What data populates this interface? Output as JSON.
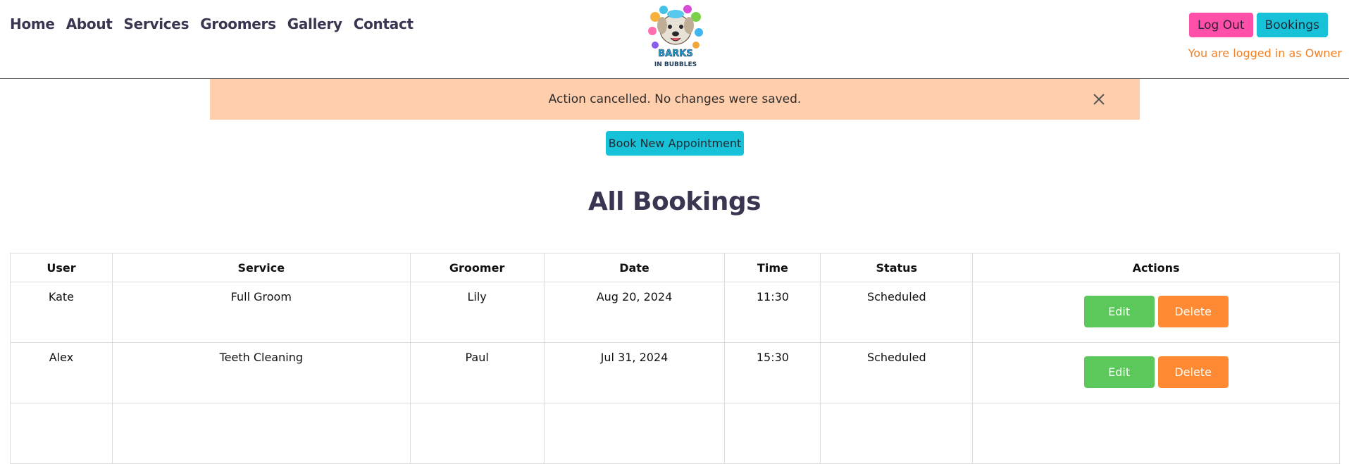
{
  "nav": {
    "items": [
      "Home",
      "About",
      "Services",
      "Groomers",
      "Gallery",
      "Contact"
    ]
  },
  "logo": {
    "name": "barks-in-bubbles-logo",
    "text_line1": "BARKS",
    "text_line2": "IN BUBBLES"
  },
  "auth": {
    "logout_label": "Log Out",
    "bookings_label": "Bookings",
    "status_text": "You are logged in as Owner"
  },
  "alert": {
    "message": "Action cancelled. No changes were saved.",
    "close_icon": "close-icon"
  },
  "book_button_label": "Book New Appointment",
  "page_title": "All Bookings",
  "table": {
    "headers": [
      "User",
      "Service",
      "Groomer",
      "Date",
      "Time",
      "Status",
      "Actions"
    ],
    "rows": [
      {
        "user": "Kate",
        "service": "Full Groom",
        "groomer": "Lily",
        "date": "Aug 20, 2024",
        "time": "11:30",
        "status": "Scheduled"
      },
      {
        "user": "Alex",
        "service": "Teeth Cleaning",
        "groomer": "Paul",
        "date": "Jul 31, 2024",
        "time": "15:30",
        "status": "Scheduled"
      }
    ],
    "edit_label": "Edit",
    "delete_label": "Delete"
  },
  "colors": {
    "brand_text": "#3b3551",
    "logout_bg": "#ff4fa8",
    "bookings_bg": "#17c1d8",
    "alert_bg": "#ffcead",
    "edit_bg": "#5cc85c",
    "delete_bg": "#ff8a33",
    "status_note": "#f0822a"
  }
}
